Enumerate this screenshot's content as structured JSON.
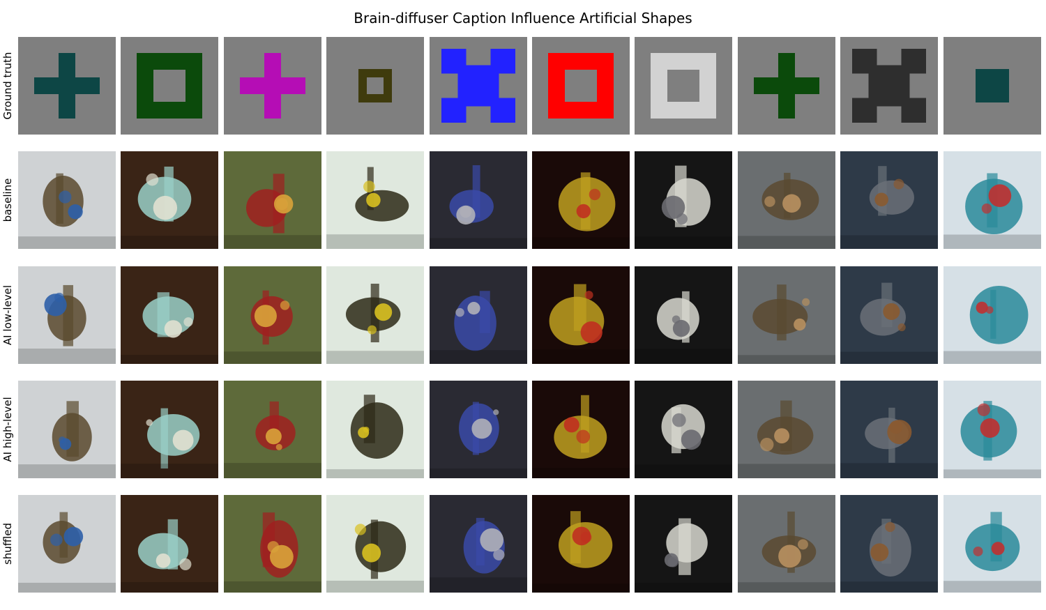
{
  "figure": {
    "title": "Brain-diffuser Caption Influence Artificial Shapes"
  },
  "rows": [
    {
      "label": "Ground truth"
    },
    {
      "label": "baseline"
    },
    {
      "label": "AI low-level"
    },
    {
      "label": "AI high-level"
    },
    {
      "label": "shuffled"
    }
  ],
  "ground_truth_shapes": [
    {
      "shape": "plus",
      "color": "#0d4645"
    },
    {
      "shape": "square-ring",
      "color": "#0b4a0b"
    },
    {
      "shape": "plus",
      "color": "#b50db5"
    },
    {
      "shape": "square-ring-small",
      "color": "#3f3b0d"
    },
    {
      "shape": "x-cross",
      "color": "#2222ff"
    },
    {
      "shape": "square-ring",
      "color": "#ff0000"
    },
    {
      "shape": "square-ring",
      "color": "#d2d2d2"
    },
    {
      "shape": "plus",
      "color": "#0b4a0b"
    },
    {
      "shape": "x-cross",
      "color": "#2e2e2e"
    },
    {
      "shape": "filled-square",
      "color": "#0d4645"
    }
  ],
  "shape_background_color": "#7f7f7f",
  "photo_palettes": [
    {
      "bg": "#cfd2d4",
      "fg": "#5a4a2e",
      "accent": "#2e5fa8"
    },
    {
      "bg": "#3a2416",
      "fg": "#9ad0c8",
      "accent": "#e0e0d0"
    },
    {
      "bg": "#5e6a3a",
      "fg": "#a02020",
      "accent": "#d9a33a"
    },
    {
      "bg": "#dfe8de",
      "fg": "#2e2a18",
      "accent": "#d8c020"
    },
    {
      "bg": "#2a2a33",
      "fg": "#3a4aa8",
      "accent": "#b0b0b8"
    },
    {
      "bg": "#1a0a08",
      "fg": "#c0a020",
      "accent": "#c03020"
    },
    {
      "bg": "#151515",
      "fg": "#d8d8d0",
      "accent": "#6a6a70"
    },
    {
      "bg": "#6a6e70",
      "fg": "#5a4a30",
      "accent": "#b89060"
    },
    {
      "bg": "#2e3a48",
      "fg": "#6a7078",
      "accent": "#8a5a30"
    },
    {
      "bg": "#d6e0e6",
      "fg": "#2a8a9a",
      "accent": "#c03030"
    }
  ]
}
